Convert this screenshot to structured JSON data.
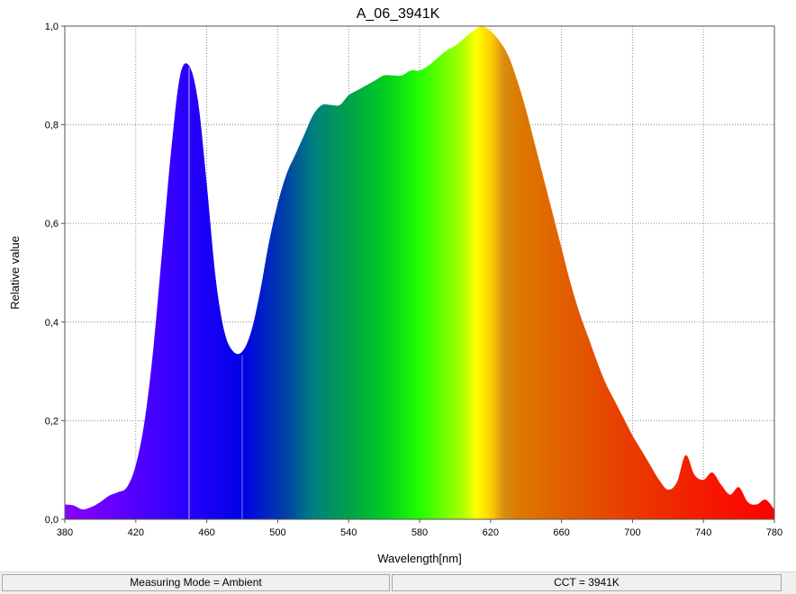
{
  "chart_data": {
    "type": "area",
    "title": "A_06_3941K",
    "xlabel": "Wavelength[nm]",
    "ylabel": "Relative value",
    "xlim": [
      380,
      780
    ],
    "ylim": [
      0,
      1.0
    ],
    "x_ticks": [
      "380",
      "420",
      "460",
      "500",
      "540",
      "580",
      "620",
      "660",
      "700",
      "740",
      "780"
    ],
    "y_ticks": [
      "0,0",
      "0,2",
      "0,4",
      "0,6",
      "0,8",
      "1,0"
    ],
    "grid": true,
    "fill": "spectral-colors",
    "x": [
      380,
      385,
      390,
      395,
      400,
      405,
      410,
      415,
      420,
      425,
      430,
      435,
      440,
      445,
      450,
      455,
      460,
      465,
      470,
      475,
      480,
      485,
      490,
      495,
      500,
      505,
      510,
      515,
      520,
      525,
      530,
      535,
      540,
      545,
      550,
      555,
      560,
      565,
      570,
      575,
      580,
      585,
      590,
      595,
      600,
      605,
      610,
      615,
      620,
      625,
      630,
      635,
      640,
      645,
      650,
      655,
      660,
      665,
      670,
      675,
      680,
      685,
      690,
      695,
      700,
      705,
      710,
      715,
      720,
      725,
      730,
      735,
      740,
      745,
      750,
      755,
      760,
      765,
      770,
      775,
      780
    ],
    "values": [
      0.03,
      0.028,
      0.02,
      0.025,
      0.035,
      0.048,
      0.055,
      0.065,
      0.11,
      0.2,
      0.35,
      0.55,
      0.75,
      0.9,
      0.92,
      0.85,
      0.68,
      0.49,
      0.38,
      0.34,
      0.34,
      0.38,
      0.46,
      0.56,
      0.64,
      0.7,
      0.74,
      0.78,
      0.82,
      0.84,
      0.84,
      0.84,
      0.86,
      0.87,
      0.88,
      0.89,
      0.9,
      0.9,
      0.9,
      0.91,
      0.91,
      0.92,
      0.935,
      0.95,
      0.96,
      0.975,
      0.99,
      1.0,
      0.99,
      0.97,
      0.94,
      0.89,
      0.83,
      0.76,
      0.69,
      0.62,
      0.55,
      0.48,
      0.42,
      0.37,
      0.32,
      0.275,
      0.24,
      0.205,
      0.17,
      0.14,
      0.11,
      0.08,
      0.06,
      0.075,
      0.13,
      0.09,
      0.08,
      0.095,
      0.07,
      0.05,
      0.065,
      0.035,
      0.03,
      0.04,
      0.02
    ]
  },
  "status": {
    "measuring_mode": "Measuring Mode = Ambient",
    "cct": "CCT = 3941K"
  },
  "colors": {
    "background": "#ffffff",
    "statusbar": "#f0f0f0"
  }
}
